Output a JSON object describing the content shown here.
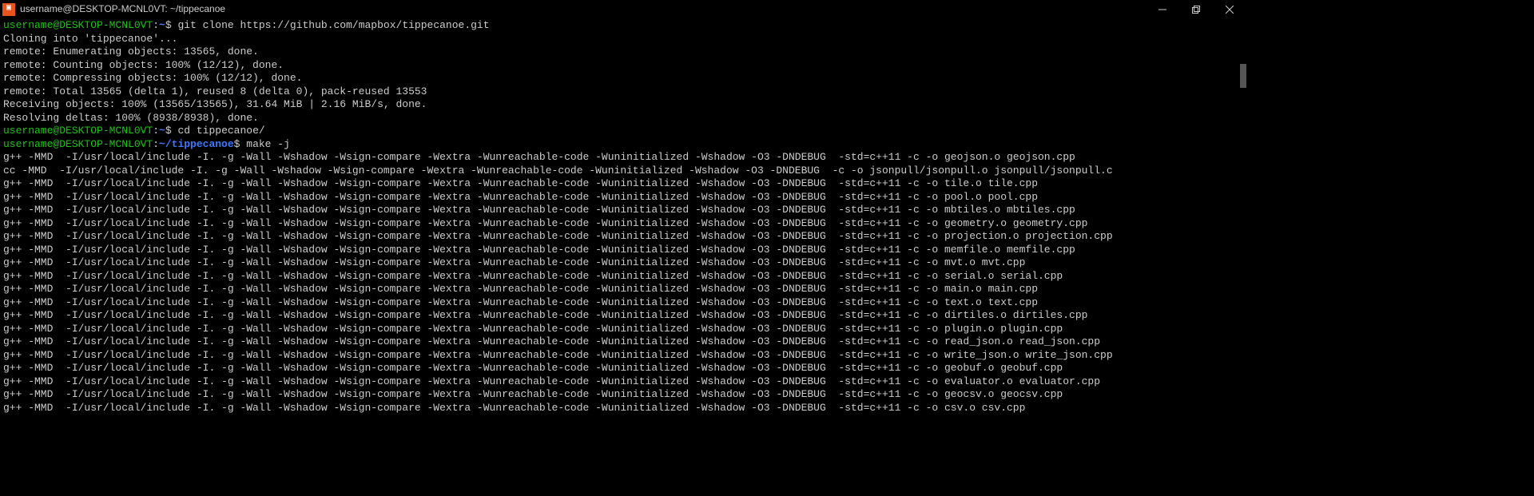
{
  "titlebar": {
    "title": "username@DESKTOP-MCNL0VT: ~/tippecanoe",
    "icon_glyph": "▣"
  },
  "prompts": [
    {
      "user": "username@DESKTOP-MCNL0VT",
      "sep1": ":",
      "path": "~",
      "sep2": "$ ",
      "cmd": "git clone https://github.com/mapbox/tippecanoe.git"
    },
    {
      "user": "username@DESKTOP-MCNL0VT",
      "sep1": ":",
      "path": "~",
      "sep2": "$ ",
      "cmd": "cd tippecanoe/"
    },
    {
      "user": "username@DESKTOP-MCNL0VT",
      "sep1": ":",
      "path": "~/tippecanoe",
      "sep2": "$ ",
      "cmd": "make -j"
    }
  ],
  "clone_output": [
    "Cloning into 'tippecanoe'...",
    "remote: Enumerating objects: 13565, done.",
    "remote: Counting objects: 100% (12/12), done.",
    "remote: Compressing objects: 100% (12/12), done.",
    "remote: Total 13565 (delta 1), reused 8 (delta 0), pack-reused 13553",
    "Receiving objects: 100% (13565/13565), 31.64 MiB | 2.16 MiB/s, done.",
    "Resolving deltas: 100% (8938/8938), done."
  ],
  "make_output": [
    "g++ -MMD  -I/usr/local/include -I. -g -Wall -Wshadow -Wsign-compare -Wextra -Wunreachable-code -Wuninitialized -Wshadow -O3 -DNDEBUG  -std=c++11 -c -o geojson.o geojson.cpp",
    "cc -MMD  -I/usr/local/include -I. -g -Wall -Wshadow -Wsign-compare -Wextra -Wunreachable-code -Wuninitialized -Wshadow -O3 -DNDEBUG  -c -o jsonpull/jsonpull.o jsonpull/jsonpull.c",
    "g++ -MMD  -I/usr/local/include -I. -g -Wall -Wshadow -Wsign-compare -Wextra -Wunreachable-code -Wuninitialized -Wshadow -O3 -DNDEBUG  -std=c++11 -c -o tile.o tile.cpp",
    "g++ -MMD  -I/usr/local/include -I. -g -Wall -Wshadow -Wsign-compare -Wextra -Wunreachable-code -Wuninitialized -Wshadow -O3 -DNDEBUG  -std=c++11 -c -o pool.o pool.cpp",
    "g++ -MMD  -I/usr/local/include -I. -g -Wall -Wshadow -Wsign-compare -Wextra -Wunreachable-code -Wuninitialized -Wshadow -O3 -DNDEBUG  -std=c++11 -c -o mbtiles.o mbtiles.cpp",
    "g++ -MMD  -I/usr/local/include -I. -g -Wall -Wshadow -Wsign-compare -Wextra -Wunreachable-code -Wuninitialized -Wshadow -O3 -DNDEBUG  -std=c++11 -c -o geometry.o geometry.cpp",
    "g++ -MMD  -I/usr/local/include -I. -g -Wall -Wshadow -Wsign-compare -Wextra -Wunreachable-code -Wuninitialized -Wshadow -O3 -DNDEBUG  -std=c++11 -c -o projection.o projection.cpp",
    "g++ -MMD  -I/usr/local/include -I. -g -Wall -Wshadow -Wsign-compare -Wextra -Wunreachable-code -Wuninitialized -Wshadow -O3 -DNDEBUG  -std=c++11 -c -o memfile.o memfile.cpp",
    "g++ -MMD  -I/usr/local/include -I. -g -Wall -Wshadow -Wsign-compare -Wextra -Wunreachable-code -Wuninitialized -Wshadow -O3 -DNDEBUG  -std=c++11 -c -o mvt.o mvt.cpp",
    "g++ -MMD  -I/usr/local/include -I. -g -Wall -Wshadow -Wsign-compare -Wextra -Wunreachable-code -Wuninitialized -Wshadow -O3 -DNDEBUG  -std=c++11 -c -o serial.o serial.cpp",
    "g++ -MMD  -I/usr/local/include -I. -g -Wall -Wshadow -Wsign-compare -Wextra -Wunreachable-code -Wuninitialized -Wshadow -O3 -DNDEBUG  -std=c++11 -c -o main.o main.cpp",
    "g++ -MMD  -I/usr/local/include -I. -g -Wall -Wshadow -Wsign-compare -Wextra -Wunreachable-code -Wuninitialized -Wshadow -O3 -DNDEBUG  -std=c++11 -c -o text.o text.cpp",
    "g++ -MMD  -I/usr/local/include -I. -g -Wall -Wshadow -Wsign-compare -Wextra -Wunreachable-code -Wuninitialized -Wshadow -O3 -DNDEBUG  -std=c++11 -c -o dirtiles.o dirtiles.cpp",
    "g++ -MMD  -I/usr/local/include -I. -g -Wall -Wshadow -Wsign-compare -Wextra -Wunreachable-code -Wuninitialized -Wshadow -O3 -DNDEBUG  -std=c++11 -c -o plugin.o plugin.cpp",
    "g++ -MMD  -I/usr/local/include -I. -g -Wall -Wshadow -Wsign-compare -Wextra -Wunreachable-code -Wuninitialized -Wshadow -O3 -DNDEBUG  -std=c++11 -c -o read_json.o read_json.cpp",
    "g++ -MMD  -I/usr/local/include -I. -g -Wall -Wshadow -Wsign-compare -Wextra -Wunreachable-code -Wuninitialized -Wshadow -O3 -DNDEBUG  -std=c++11 -c -o write_json.o write_json.cpp",
    "g++ -MMD  -I/usr/local/include -I. -g -Wall -Wshadow -Wsign-compare -Wextra -Wunreachable-code -Wuninitialized -Wshadow -O3 -DNDEBUG  -std=c++11 -c -o geobuf.o geobuf.cpp",
    "g++ -MMD  -I/usr/local/include -I. -g -Wall -Wshadow -Wsign-compare -Wextra -Wunreachable-code -Wuninitialized -Wshadow -O3 -DNDEBUG  -std=c++11 -c -o evaluator.o evaluator.cpp",
    "g++ -MMD  -I/usr/local/include -I. -g -Wall -Wshadow -Wsign-compare -Wextra -Wunreachable-code -Wuninitialized -Wshadow -O3 -DNDEBUG  -std=c++11 -c -o geocsv.o geocsv.cpp",
    "g++ -MMD  -I/usr/local/include -I. -g -Wall -Wshadow -Wsign-compare -Wextra -Wunreachable-code -Wuninitialized -Wshadow -O3 -DNDEBUG  -std=c++11 -c -o csv.o csv.cpp"
  ]
}
